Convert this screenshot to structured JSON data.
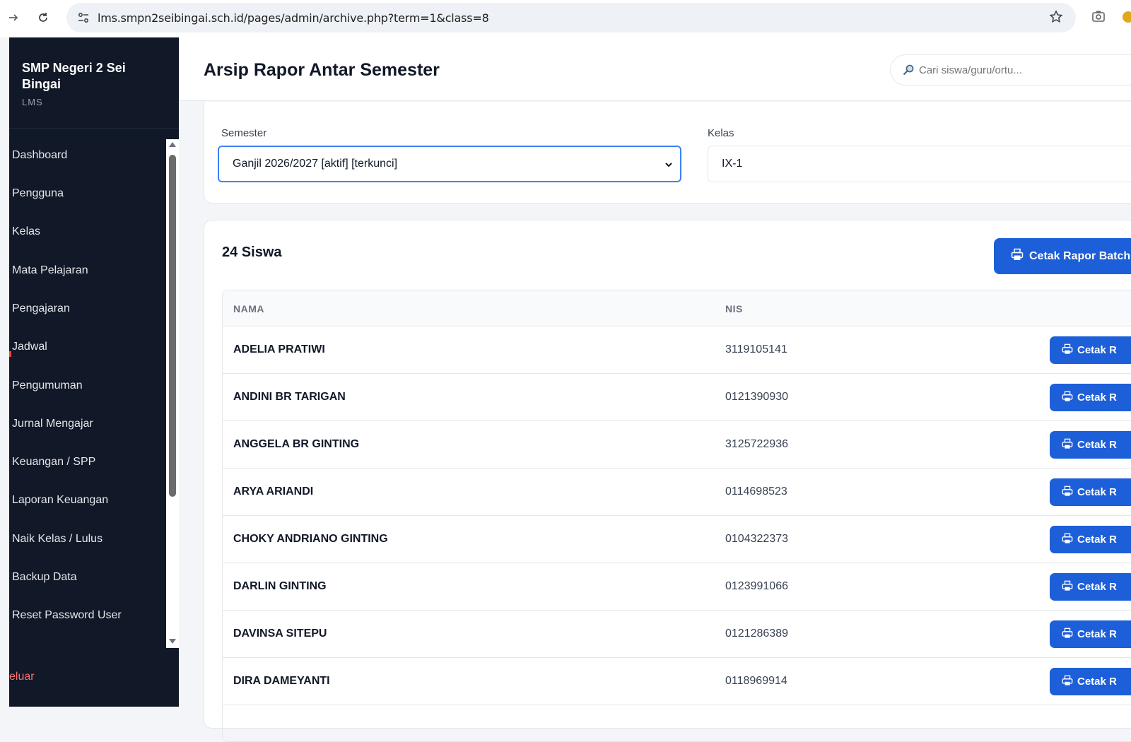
{
  "browser": {
    "url": "lms.smpn2seibingai.sch.id/pages/admin/archive.php?term=1&class=8"
  },
  "sidebar": {
    "brand": "SMP Negeri 2 Sei Bingai",
    "sub": "LMS",
    "items": [
      {
        "label": "Dashboard"
      },
      {
        "label": "Pengguna"
      },
      {
        "label": "Kelas"
      },
      {
        "label": "Mata Pelajaran"
      },
      {
        "label": "Pengajaran"
      },
      {
        "label": "Jadwal"
      },
      {
        "label": "Pengumuman"
      },
      {
        "label": "Jurnal Mengajar"
      },
      {
        "label": "Keuangan / SPP"
      },
      {
        "label": "Laporan Keuangan"
      },
      {
        "label": "Naik Kelas / Lulus"
      },
      {
        "label": "Backup Data"
      },
      {
        "label": "Reset Password User"
      }
    ],
    "logout": "eluar"
  },
  "header": {
    "title": "Arsip Rapor Antar Semester",
    "search_placeholder": "Cari siswa/guru/ortu..."
  },
  "filters": {
    "semester_label": "Semester",
    "semester_value": "Ganjil 2026/2027 [aktif] [terkunci]",
    "kelas_label": "Kelas",
    "kelas_value": "IX-1"
  },
  "students": {
    "count_label": "24 Siswa",
    "batch_button": "Cetak Rapor Batch",
    "columns": {
      "name": "NAMA",
      "nis": "NIS"
    },
    "row_button": "Cetak R",
    "rows": [
      {
        "name": "ADELIA PRATIWI",
        "nis": "3119105141"
      },
      {
        "name": "ANDINI BR TARIGAN",
        "nis": "0121390930"
      },
      {
        "name": "ANGGELA BR GINTING",
        "nis": "3125722936"
      },
      {
        "name": "ARYA ARIANDI",
        "nis": "0114698523"
      },
      {
        "name": "CHOKY ANDRIANO GINTING",
        "nis": "0104322373"
      },
      {
        "name": "DARLIN GINTING",
        "nis": "0123991066"
      },
      {
        "name": "DAVINSA SITEPU",
        "nis": "0121286389"
      },
      {
        "name": "DIRA DAMEYANTI",
        "nis": "0118969914"
      }
    ]
  },
  "colors": {
    "sidebar_bg": "#111827",
    "primary_button": "#1d5fd8",
    "focus_border": "#3b82f6",
    "logout_text": "#f87171"
  }
}
